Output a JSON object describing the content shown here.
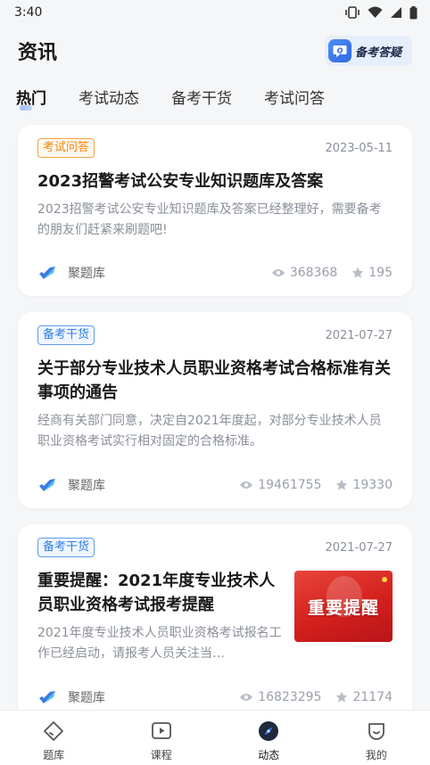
{
  "status_bar": {
    "time": "3:40"
  },
  "header": {
    "title": "资讯",
    "qa_button_label": "备考答疑"
  },
  "tabs": [
    {
      "label": "热门",
      "active": true
    },
    {
      "label": "考试动态",
      "active": false
    },
    {
      "label": "备考干货",
      "active": false
    },
    {
      "label": "考试问答",
      "active": false
    }
  ],
  "articles": [
    {
      "tag": "考试问答",
      "tag_color": "#f0850f",
      "date": "2023-05-11",
      "title": "2023招警考试公安专业知识题库及答案",
      "summary": "2023招警考试公安专业知识题库及答案已经整理好，需要备考的朋友们赶紧来刷题吧!",
      "source": "聚题库",
      "views": "368368",
      "stars": "195"
    },
    {
      "tag": "备考干货",
      "tag_color": "#2f7ee6",
      "date": "2021-07-27",
      "title": "关于部分专业技术人员职业资格考试合格标准有关事项的通告",
      "summary": "经商有关部门同意，决定自2021年度起，对部分专业技术人员职业资格考试实行相对固定的合格标准。",
      "source": "聚题库",
      "views": "19461755",
      "stars": "19330"
    },
    {
      "tag": "备考干货",
      "tag_color": "#2f7ee6",
      "date": "2021-07-27",
      "title": "重要提醒：2021年度专业技术人员职业资格考试报考提醒",
      "summary": "2021年度专业技术人员职业资格考试报名工作已经启动，请报考人员关注当…",
      "thumbnail_text": "重要提醒",
      "source": "聚题库",
      "views": "16823295",
      "stars": "21174"
    }
  ],
  "bottom_nav": [
    {
      "label": "题库",
      "icon": "question-bank-icon"
    },
    {
      "label": "课程",
      "icon": "course-play-icon"
    },
    {
      "label": "动态",
      "icon": "compass-icon",
      "active": true
    },
    {
      "label": "我的",
      "icon": "profile-icon"
    }
  ],
  "colors": {
    "accent": "#2f7ee6",
    "background": "#f5f6f8"
  }
}
